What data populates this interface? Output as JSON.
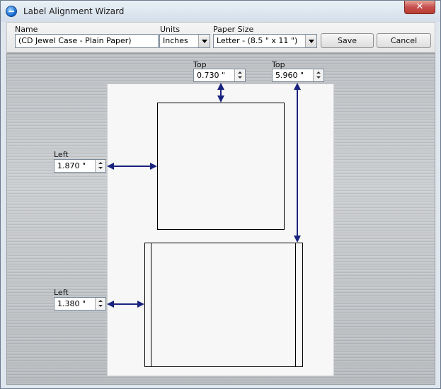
{
  "window": {
    "title": "Label Alignment Wizard",
    "close_glyph": "✕"
  },
  "toolbar": {
    "name_label": "Name",
    "name_value": "(CD Jewel Case - Plain Paper)",
    "units_label": "Units",
    "units_value": "Inches",
    "paper_size_label": "Paper Size",
    "paper_size_value": "Letter - (8.5 \" x 11 \")",
    "save_label": "Save",
    "cancel_label": "Cancel"
  },
  "offsets": {
    "top1_label": "Top",
    "top1_value": "0.730 \"",
    "top2_label": "Top",
    "top2_value": "5.960 \"",
    "left1_label": "Left",
    "left1_value": "1.870 \"",
    "left2_label": "Left",
    "left2_value": "1.380 \""
  },
  "icons": {
    "app": "app-logo-icon",
    "close": "close-icon",
    "dropdown": "chevron-down-icon",
    "spinner": "spinner-arrows-icon",
    "arrow": "double-arrow-icon"
  },
  "colors": {
    "arrow": "#1a237e",
    "close": "#c75050"
  }
}
